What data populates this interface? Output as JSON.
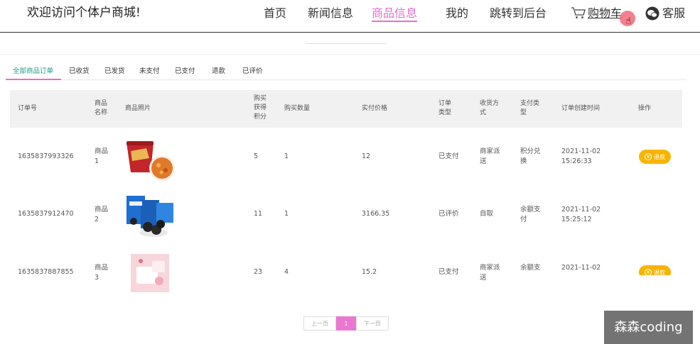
{
  "site_title": "欢迎访问个体户商城!",
  "nav": {
    "items": [
      "首页",
      "新闻信息",
      "商品信息",
      "我的",
      "跳转到后台"
    ],
    "active_index": 2,
    "cart_label": "购物车",
    "service_label": "客服"
  },
  "tabs": [
    {
      "label": "全部商品订单",
      "active": true
    },
    {
      "label": "已收货",
      "active": false
    },
    {
      "label": "已发货",
      "active": false
    },
    {
      "label": "未支付",
      "active": false
    },
    {
      "label": "已支付",
      "active": false
    },
    {
      "label": "退款",
      "active": false
    },
    {
      "label": "已评价",
      "active": false
    }
  ],
  "table": {
    "headers": [
      "订单号",
      "商品名称",
      "商品照片",
      "购买获得积分",
      "购买数量",
      "实付价格",
      "订单类型",
      "收货方式",
      "支付类型",
      "订单创建时间",
      "操作"
    ],
    "rows": [
      {
        "order_no": "1635837993326",
        "name": "商品1",
        "points": "5",
        "qty": "1",
        "price": "12",
        "type": "已支付",
        "delivery": "商家派送",
        "pay": "积分兑换",
        "time": "2021-11-02 15:26:33",
        "action": "退款",
        "photo": "noodles"
      },
      {
        "order_no": "1635837912470",
        "name": "商品2",
        "points": "11",
        "qty": "1",
        "price": "3166.35",
        "type": "已评价",
        "delivery": "自取",
        "pay": "余额支付",
        "time": "2021-11-02 15:25:12",
        "action": "",
        "photo": "cookies"
      },
      {
        "order_no": "1635837887855",
        "name": "商品3",
        "points": "23",
        "qty": "4",
        "price": "15.2",
        "type": "已支付",
        "delivery": "商家派送",
        "pay": "余额支",
        "time": "2021-11-02",
        "action": "退款",
        "photo": "pink"
      }
    ]
  },
  "pager": {
    "prev": "上一页",
    "current": "1",
    "next": "下一页"
  },
  "watermark": "森森coding",
  "colors": {
    "accent": "#e86ccf",
    "tab_active": "#1a9c8c",
    "refund": "#f8b400"
  }
}
